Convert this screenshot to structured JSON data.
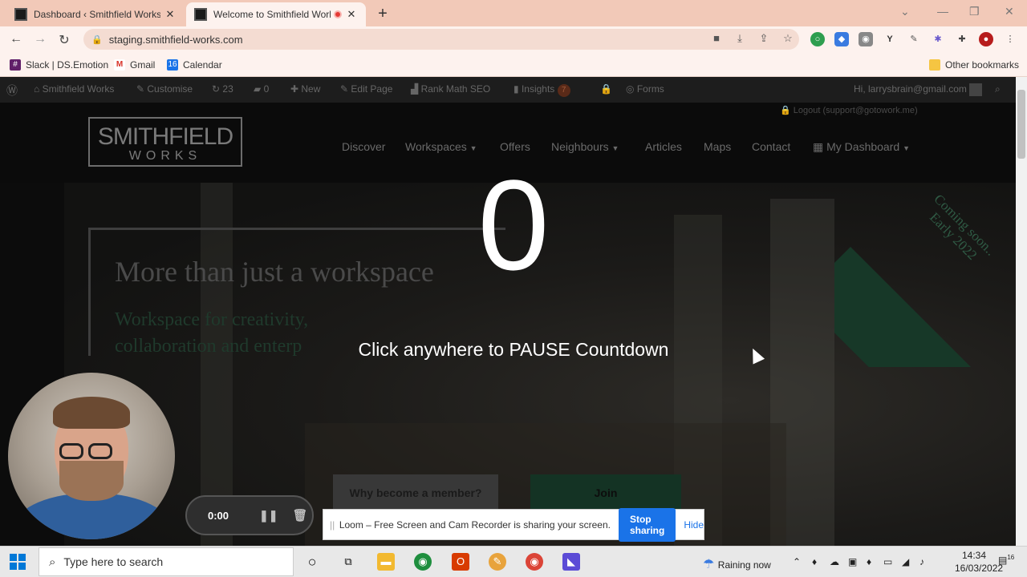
{
  "browser": {
    "tabs": [
      {
        "title": "Dashboard ‹ Smithfield Works —",
        "active": false
      },
      {
        "title": "Welcome to Smithfield Work",
        "active": true,
        "recording": true
      }
    ],
    "url": "staging.smithfield-works.com",
    "window_controls": {
      "minimize": "—",
      "maximize": "❐",
      "close": "✕"
    },
    "bookmarks": [
      {
        "label": "Slack | DS.Emotion",
        "icon": "slack-icon"
      },
      {
        "label": "Gmail",
        "icon": "gmail-icon"
      },
      {
        "label": "Calendar",
        "icon": "calendar-icon"
      }
    ],
    "other_bookmarks": "Other bookmarks"
  },
  "wp_admin_bar": {
    "site_name": "Smithfield Works",
    "customise": "Customise",
    "updates_count": "23",
    "comments_count": "0",
    "new": "New",
    "edit_page": "Edit Page",
    "rank_math": "Rank Math SEO",
    "insights": "Insights",
    "insights_badge": "7",
    "forms": "Forms",
    "greeting": "Hi, larrysbrain@gmail.com",
    "logout": "Logout (support@gotowork.me)"
  },
  "site": {
    "logo_line1": "SMITHFIELD",
    "logo_line2": "WORKS",
    "menu": [
      {
        "label": "Discover",
        "dropdown": false
      },
      {
        "label": "Workspaces",
        "dropdown": true
      },
      {
        "label": "Offers",
        "dropdown": false
      },
      {
        "label": "Neighbours",
        "dropdown": true
      },
      {
        "label": "Articles",
        "dropdown": false
      },
      {
        "label": "Maps",
        "dropdown": false
      },
      {
        "label": "Contact",
        "dropdown": false
      },
      {
        "label": "My Dashboard",
        "dropdown": true
      }
    ],
    "hero_title": "More than just a workspace",
    "hero_subtitle": "Workspace for creativity, collaboration and enterp",
    "ribbon_text": "Coming soon.. Early 2022",
    "btn_member": "Why become a member?",
    "btn_join": "Join"
  },
  "loom": {
    "countdown": "0",
    "pause_message": "Click anywhere to PAUSE Countdown",
    "timer": "0:00",
    "share_message": "Loom – Free Screen and Cam Recorder is sharing your screen.",
    "stop_sharing": "Stop sharing",
    "hide": "Hide"
  },
  "taskbar": {
    "search_placeholder": "Type here to search",
    "weather": "Raining now",
    "time": "14:34",
    "date": "16/03/2022",
    "notifications": "16"
  },
  "colors": {
    "tab_strip": "#f2c9b8",
    "toolbar": "#fdf2ee",
    "accent_blue": "#1a73e8",
    "hero_green": "#173828"
  }
}
